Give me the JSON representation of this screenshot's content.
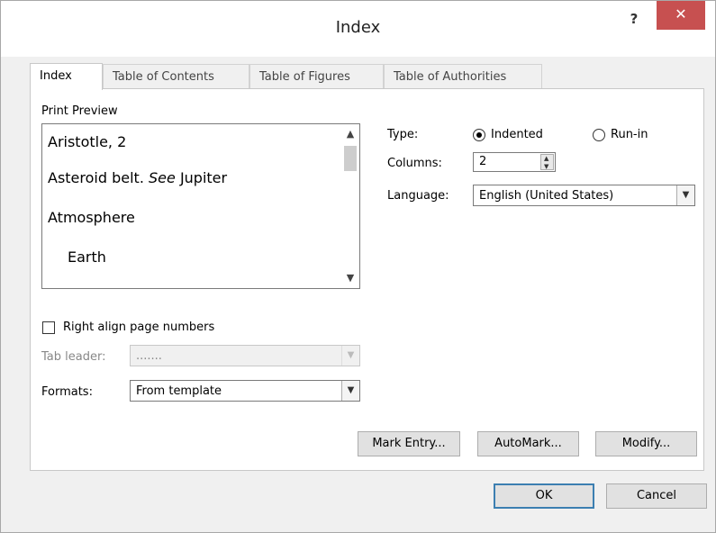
{
  "window": {
    "title": "Index",
    "help_label": "?",
    "close_label": "✕"
  },
  "tabs": [
    {
      "label": "Index"
    },
    {
      "label": "Table of Contents"
    },
    {
      "label": "Table of Figures"
    },
    {
      "label": "Table of Authorities"
    }
  ],
  "print_preview": {
    "label": "Print Preview",
    "lines": [
      "Aristotle, 2",
      "Asteroid belt.",
      "See",
      "Jupiter",
      "Atmosphere",
      "Earth"
    ],
    "scroll_up": "▲",
    "scroll_down": "▼"
  },
  "type": {
    "label": "Type:",
    "options": [
      "Indented",
      "Run-in"
    ],
    "selected": "Indented"
  },
  "columns": {
    "label": "Columns:",
    "value": "2"
  },
  "language": {
    "label": "Language:",
    "value": "English (United States)"
  },
  "right_align": {
    "label": "Right align page numbers",
    "checked": false
  },
  "tab_leader": {
    "label": "Tab leader:",
    "value": "......."
  },
  "formats": {
    "label": "Formats:",
    "value": "From template"
  },
  "buttons": {
    "mark_entry": "Mark Entry...",
    "automark": "AutoMark...",
    "modify": "Modify...",
    "ok": "OK",
    "cancel": "Cancel"
  },
  "icons": {
    "dropdown": "chevron-down-icon",
    "spin_up": "spin-up-icon",
    "spin_down": "spin-down-icon"
  }
}
